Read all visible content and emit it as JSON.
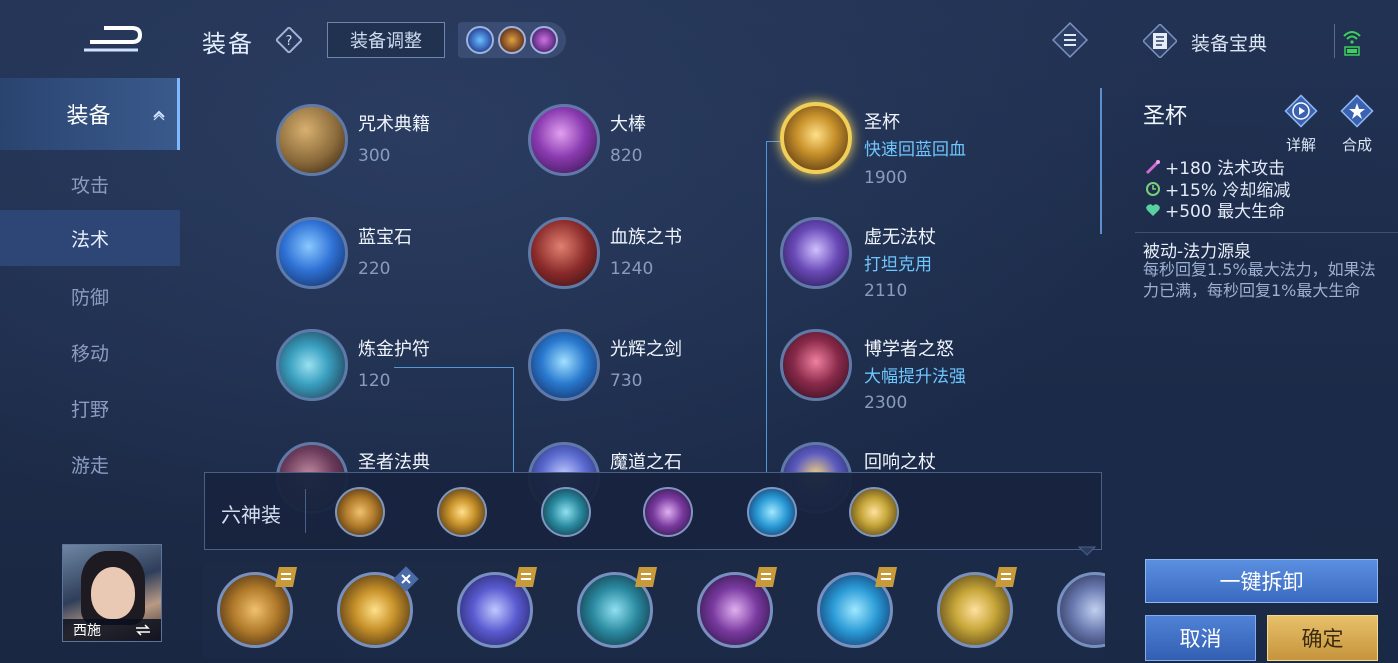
{
  "header": {
    "title": "装备",
    "adjust_label": "装备调整",
    "codex_label": "装备宝典"
  },
  "sidebar": {
    "items": [
      {
        "label": "装备"
      },
      {
        "label": "攻击"
      },
      {
        "label": "法术"
      },
      {
        "label": "防御"
      },
      {
        "label": "移动"
      },
      {
        "label": "打野"
      },
      {
        "label": "游走"
      }
    ]
  },
  "hero": {
    "name": "西施"
  },
  "items": [
    {
      "name": "咒术典籍",
      "desc": "",
      "price": "300",
      "color": "#8a6a3a"
    },
    {
      "name": "蓝宝石",
      "desc": "",
      "price": "220",
      "color": "#2f72d6"
    },
    {
      "name": "炼金护符",
      "desc": "",
      "price": "120",
      "color": "#3aa0c0"
    },
    {
      "name": "圣者法典",
      "desc": "",
      "price": "",
      "color": "#6a3a5a"
    },
    {
      "name": "大棒",
      "desc": "",
      "price": "820",
      "color": "#8a3ab0"
    },
    {
      "name": "血族之书",
      "desc": "",
      "price": "1240",
      "color": "#8a2a2a"
    },
    {
      "name": "光辉之剑",
      "desc": "",
      "price": "730",
      "color": "#2a7ad0"
    },
    {
      "name": "魔道之石",
      "desc": "",
      "price": "",
      "color": "#5a6ad0"
    },
    {
      "name": "圣杯",
      "desc": "快速回蓝回血",
      "price": "1900",
      "color": "#c8922a"
    },
    {
      "name": "虚无法杖",
      "desc": "打坦克用",
      "price": "2110",
      "color": "#6a4ab8"
    },
    {
      "name": "博学者之怒",
      "desc": "大幅提升法强",
      "price": "2300",
      "color": "#8a2a4a"
    },
    {
      "name": "回响之杖",
      "desc": "",
      "price": "",
      "color": "#5a5ac0"
    }
  ],
  "six_gods": {
    "label": "六神装",
    "items": [
      {
        "color": "#b07a2a"
      },
      {
        "color": "#c8922a"
      },
      {
        "color": "#2a8aa0"
      },
      {
        "color": "#7a3aa0"
      },
      {
        "color": "#2a9ad6"
      },
      {
        "color": "#c8a83a"
      }
    ]
  },
  "equipped": [
    {
      "color": "#b07a2a"
    },
    {
      "color": "#c8922a"
    },
    {
      "color": "#5a5ad0"
    },
    {
      "color": "#2a8aa0"
    },
    {
      "color": "#7a3aa0"
    },
    {
      "color": "#2a9ad6"
    },
    {
      "color": "#c8a83a"
    },
    {
      "color": "#6a7ab0"
    }
  ],
  "detail": {
    "title": "圣杯",
    "detail_label": "详解",
    "compose_label": "合成",
    "stats": [
      {
        "text": "+180 法术攻击",
        "icon": "magic-wand-icon",
        "color": "#d46ad8"
      },
      {
        "text": "+15% 冷却缩减",
        "icon": "clock-icon",
        "color": "#7ad07a"
      },
      {
        "text": "+500 最大生命",
        "icon": "heart-icon",
        "color": "#5ad0a0"
      }
    ],
    "passive_name": "被动-法力源泉",
    "passive_desc": "每秒回复1.5%最大法力，如果法力已满，每秒回复1%最大生命",
    "unload_label": "一键拆卸",
    "cancel_label": "取消",
    "confirm_label": "确定"
  }
}
